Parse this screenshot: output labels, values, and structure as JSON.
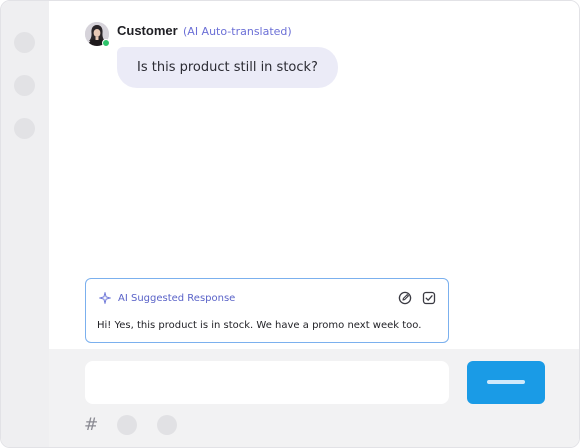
{
  "conversation": {
    "sender_name": "Customer",
    "translation_tag": "(AI Auto-translated)",
    "message_text": "Is this product still in stock?",
    "avatar_icon": "customer-avatar",
    "status_color": "#2ec36a"
  },
  "ai_suggestion": {
    "title": "AI Suggested Response",
    "text": "Hi! Yes, this product is in stock. We have a promo next week too.",
    "border_color": "#7bb0ee",
    "icons": [
      "sparkle-icon",
      "edit-icon",
      "accept-icon"
    ]
  },
  "composer": {
    "input_value": "",
    "hash_symbol": "#",
    "send_color": "#1a9be6"
  }
}
